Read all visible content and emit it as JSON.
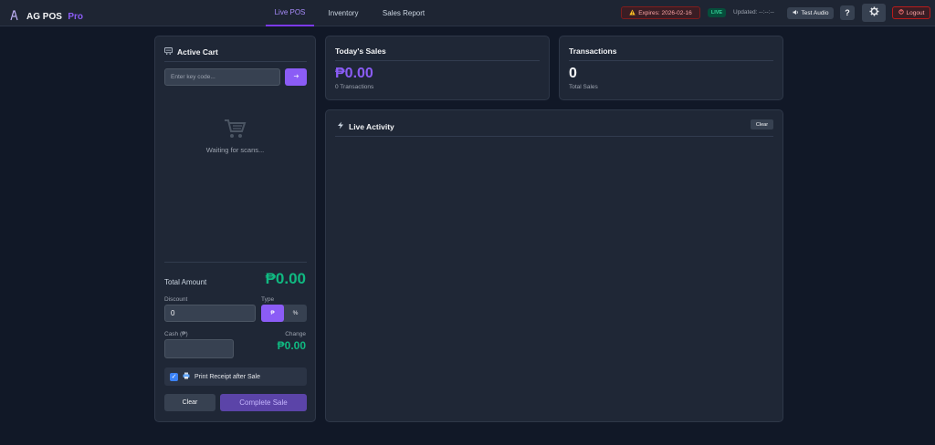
{
  "app": {
    "name": "AG POS",
    "edition": "Pro"
  },
  "nav": {
    "tabs": [
      {
        "label": "Live POS"
      },
      {
        "label": "Inventory"
      },
      {
        "label": "Sales Report"
      }
    ]
  },
  "header": {
    "expires": "Expires: 2026-02-16",
    "live_badge": "LIVE",
    "updated": "Updated: --:--:--",
    "test_audio": "Test Audio",
    "help": "?",
    "logout": "Logout"
  },
  "cart": {
    "title": "Active Cart",
    "key_input": {
      "placeholder": "Enter key code...",
      "value": ""
    },
    "empty_message": "Waiting for scans...",
    "total_label": "Total Amount",
    "total_value": "₱0.00",
    "discount_label": "Discount",
    "discount_value": "0",
    "type_label": "Type",
    "type_options": [
      "₱",
      "%"
    ],
    "type_selected": "₱",
    "cash_label": "Cash (₱)",
    "cash_value": "",
    "change_label": "Change",
    "change_value": "₱0.00",
    "print_receipt_label": "Print Receipt after Sale",
    "print_receipt_checked": true,
    "clear_label": "Clear",
    "complete_label": "Complete Sale"
  },
  "todays_sales": {
    "title": "Today's Sales",
    "value": "₱0.00",
    "sub": "0 Transactions"
  },
  "transactions": {
    "title": "Transactions",
    "value": "0",
    "sub": "Total Sales"
  },
  "activity": {
    "title": "Live Activity",
    "clear_label": "Clear"
  },
  "colors": {
    "accent": "#8b5cf6",
    "success": "#10b981",
    "danger": "#fca5a5",
    "background": "#111827",
    "panel": "#1f2736"
  },
  "icons": {
    "brand": "logo-icon",
    "warning": "warning-icon",
    "audio": "speaker-icon",
    "settings": "gear-icon",
    "logout": "logout-icon",
    "cart": "cart-icon",
    "activity": "bolt-icon",
    "printer": "printer-icon"
  }
}
